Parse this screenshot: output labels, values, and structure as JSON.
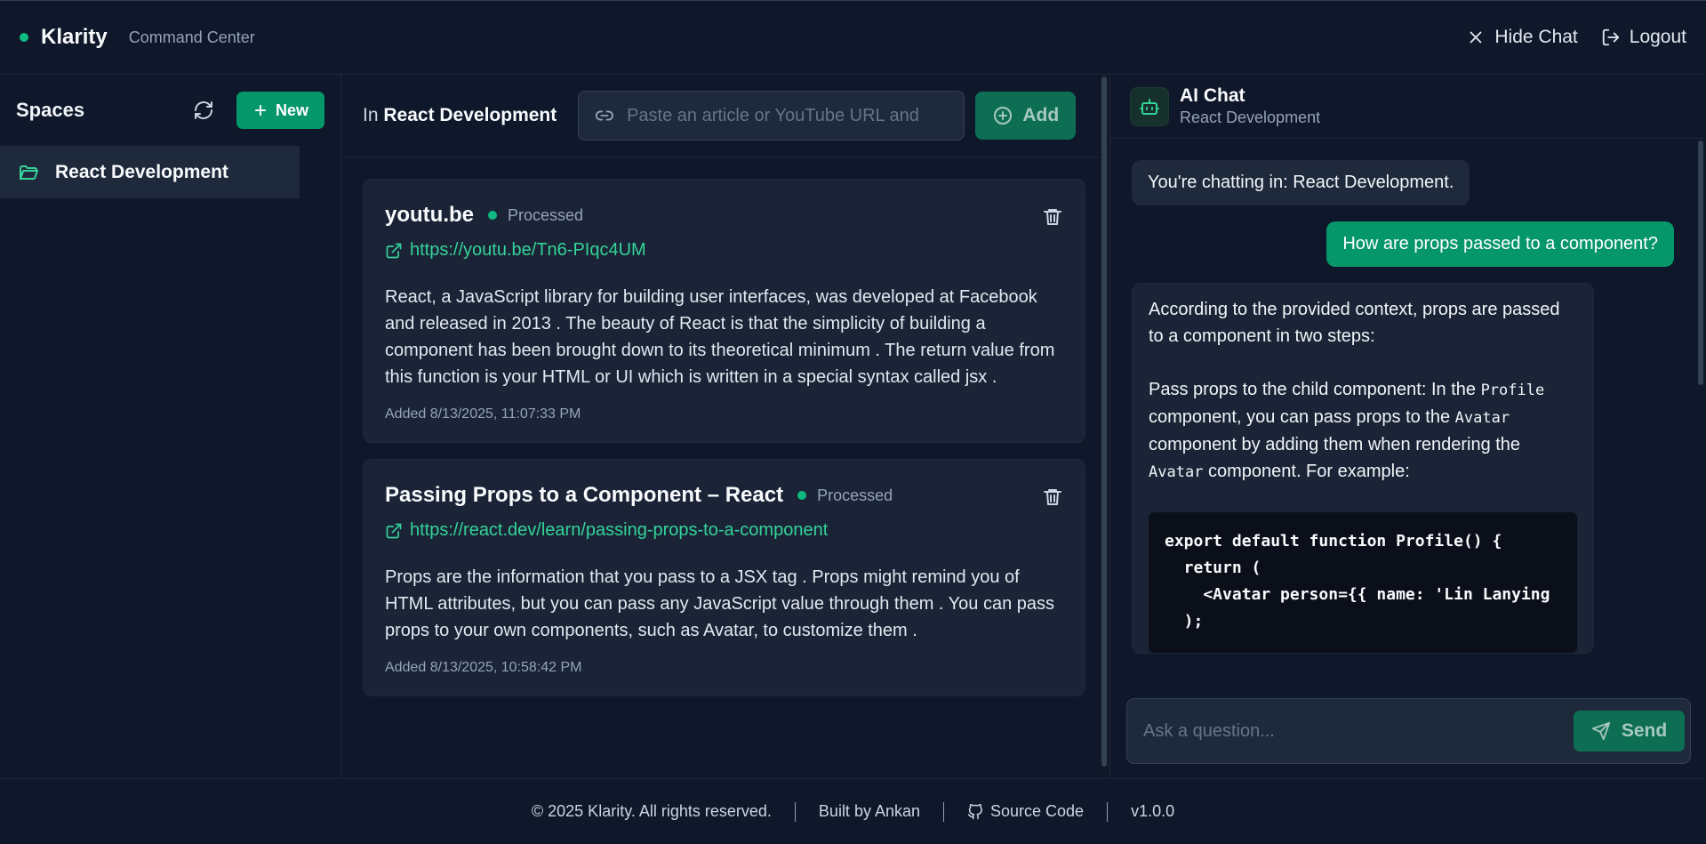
{
  "header": {
    "brand": "Klarity",
    "subtitle": "Command Center",
    "hide_chat": "Hide Chat",
    "logout": "Logout"
  },
  "sidebar": {
    "title": "Spaces",
    "new_label": "New",
    "items": [
      {
        "label": "React Development",
        "active": true
      }
    ]
  },
  "main": {
    "in_prefix": "In",
    "space_name": "React Development",
    "url_placeholder": "Paste an article or YouTube URL and",
    "add_label": "Add",
    "cards": [
      {
        "title": "youtu.be",
        "status": "Processed",
        "url": "https://youtu.be/Tn6-PIqc4UM",
        "description": "React, a JavaScript library for building user interfaces, was developed at Facebook and released in 2013 . The beauty of React is that the simplicity of building a component has been brought down to its theoretical minimum . The return value from this function is your HTML or UI which is written in a special syntax called jsx .",
        "added": "Added 8/13/2025, 11:07:33 PM"
      },
      {
        "title": "Passing Props to a Component – React",
        "status": "Processed",
        "url": "https://react.dev/learn/passing-props-to-a-component",
        "description": "Props are the information that you pass to a JSX tag . Props might remind you of HTML attributes, but you can pass any JavaScript value through them . You can pass props to your own components, such as Avatar, to customize them .",
        "added": "Added 8/13/2025, 10:58:42 PM"
      }
    ]
  },
  "chat": {
    "title": "AI Chat",
    "subtitle": "React Development",
    "system_message": "You're chatting in: React Development.",
    "user_message": "How are props passed to a component?",
    "ai_intro": "According to the provided context, props are passed to a component in two steps:",
    "ai_step_a": "Pass props to the child component: In the",
    "ai_code_profile": "Profile",
    "ai_step_b": "component, you can pass props to the",
    "ai_code_avatar": "Avatar",
    "ai_step_c": "component by adding them when rendering the",
    "ai_code_avatar2": "Avatar",
    "ai_step_d": "component. For example:",
    "code_line1": "export default function Profile() {",
    "code_line2": "  return (",
    "code_line3": "    <Avatar person={{ name: 'Lin Lanying",
    "code_line4": "  );",
    "input_placeholder": "Ask a question...",
    "send_label": "Send"
  },
  "footer": {
    "copyright": "© 2025 Klarity. All rights reserved.",
    "built_by": "Built by Ankan",
    "source": "Source Code",
    "version": "v1.0.0"
  },
  "colors": {
    "accent": "#059669",
    "link": "#34d399",
    "background": "#0f172a"
  }
}
